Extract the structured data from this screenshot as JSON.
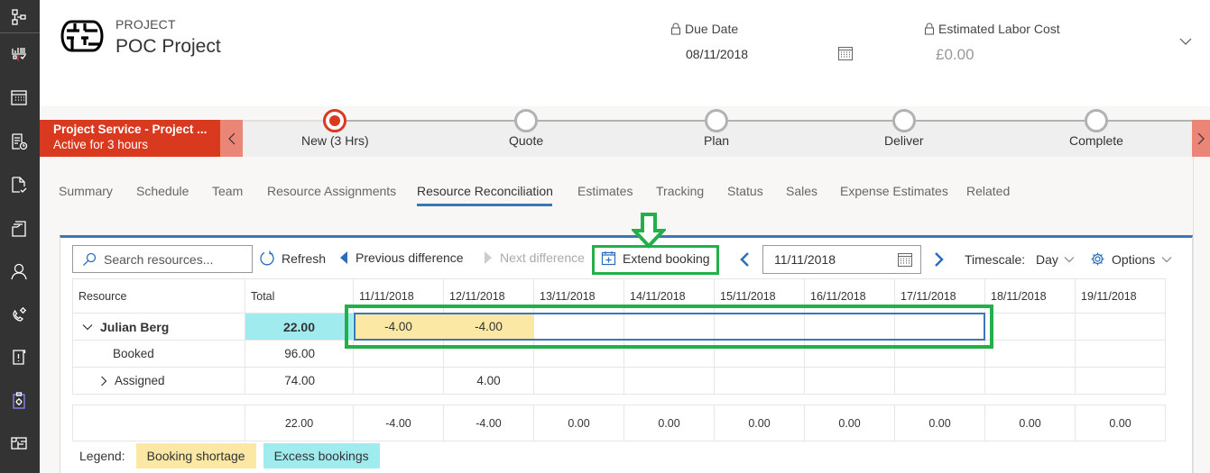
{
  "nav_rail": {
    "icons": [
      "sitemap-icon",
      "resource-matrix-icon",
      "calendar-icon",
      "time-entry-icon",
      "document-check-icon",
      "folder-documents-icon",
      "person-icon",
      "phone-settings-icon",
      "alert-document-icon",
      "clipboard-settings-icon",
      "project-board-icon"
    ]
  },
  "header": {
    "entity_type": "PROJECT",
    "entity_name": "POC Project",
    "due_date": {
      "label": "Due Date",
      "value": "08/11/2018",
      "locked": true
    },
    "estimated_labor_cost": {
      "label": "Estimated Labor Cost",
      "value": "£0.00",
      "locked": true
    }
  },
  "process": {
    "active_flow": {
      "title": "Project Service - Project ...",
      "subtitle": "Active for 3 hours"
    },
    "stages": [
      {
        "label": "New  (3 Hrs)",
        "active": true
      },
      {
        "label": "Quote",
        "active": false
      },
      {
        "label": "Plan",
        "active": false
      },
      {
        "label": "Deliver",
        "active": false
      },
      {
        "label": "Complete",
        "active": false
      }
    ],
    "colors": {
      "active": "#d9391f",
      "nav_button": "#ea8577",
      "inactive": "#b2b2b2"
    }
  },
  "tabs": [
    {
      "label": "Summary",
      "active": false
    },
    {
      "label": "Schedule",
      "active": false
    },
    {
      "label": "Team",
      "active": false
    },
    {
      "label": "Resource Assignments",
      "active": false
    },
    {
      "label": "Resource Reconciliation",
      "active": true
    },
    {
      "label": "Estimates",
      "active": false
    },
    {
      "label": "Tracking",
      "active": false
    },
    {
      "label": "Status",
      "active": false
    },
    {
      "label": "Sales",
      "active": false
    },
    {
      "label": "Expense Estimates",
      "active": false
    },
    {
      "label": "Related",
      "active": false
    }
  ],
  "toolbar": {
    "search_placeholder": "Search resources...",
    "refresh": "Refresh",
    "previous_difference": "Previous difference",
    "next_difference": "Next difference",
    "extend_booking": "Extend booking",
    "date": "11/11/2018",
    "timescale_label": "Timescale:",
    "timescale_value": "Day",
    "options": "Options"
  },
  "grid": {
    "headers": [
      "Resource",
      "Total",
      "11/11/2018",
      "12/11/2018",
      "13/11/2018",
      "14/11/2018",
      "15/11/2018",
      "16/11/2018",
      "17/11/2018",
      "18/11/2018",
      "19/11/2018"
    ],
    "rows": [
      {
        "name": "Julian Berg",
        "expanded": true,
        "total": "22.00",
        "cells": [
          "-4.00",
          "-4.00",
          "",
          "",
          "",
          "",
          "",
          "",
          ""
        ]
      },
      {
        "name": "Booked",
        "total": "96.00",
        "cells": [
          "",
          "",
          "",
          "",
          "",
          "",
          "",
          "",
          ""
        ]
      },
      {
        "name": "Assigned",
        "expanded": false,
        "total": "74.00",
        "cells": [
          "",
          "4.00",
          "",
          "",
          "",
          "",
          "",
          "",
          ""
        ]
      }
    ],
    "totals": {
      "total": "22.00",
      "cells": [
        "-4.00",
        "-4.00",
        "0.00",
        "0.00",
        "0.00",
        "0.00",
        "0.00",
        "0.00",
        "0.00"
      ]
    }
  },
  "legend": {
    "label": "Legend:",
    "items": [
      {
        "label": "Booking shortage",
        "color": "#fae8a4"
      },
      {
        "label": "Excess bookings",
        "color": "#a0ebee"
      }
    ]
  },
  "annotation_color": "#23b04b"
}
